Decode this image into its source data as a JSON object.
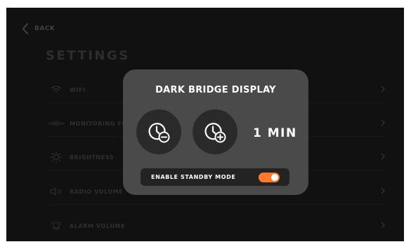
{
  "nav": {
    "back_label": "BACK"
  },
  "page": {
    "title": "SETTINGS"
  },
  "menu": {
    "items": [
      {
        "label": "WIFI",
        "icon": "wifi-icon"
      },
      {
        "label": "MONITORING FR",
        "icon": "waveform-icon"
      },
      {
        "label": "BRIGHTNESS",
        "icon": "sun-icon"
      },
      {
        "label": "RADIO VOLUME",
        "icon": "speaker-icon"
      },
      {
        "label": "ALARM VOLUME",
        "icon": "alarm-bell-icon"
      }
    ]
  },
  "dialog": {
    "title": "DARK BRIDGE DISPLAY",
    "decrease_icon": "clock-minus-icon",
    "increase_icon": "clock-plus-icon",
    "timer_value": "1 MIN",
    "standby_label": "ENABLE STANDBY MODE",
    "standby_enabled": true
  },
  "colors": {
    "background": "#1c1c1c",
    "dialog": "#4a4a4a",
    "accent": "#ff7a2f"
  }
}
